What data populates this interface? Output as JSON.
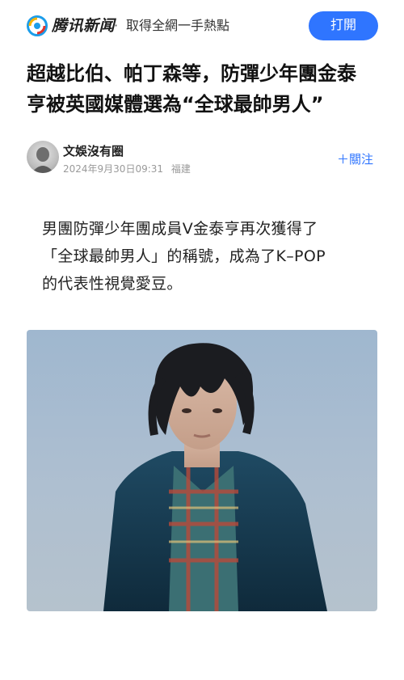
{
  "header": {
    "brand_name": "腾讯新闻",
    "separator": "·",
    "tagline": "取得全網一手熱點",
    "open_button": "打開",
    "accent_color": "#2f75ff"
  },
  "article": {
    "title_lines": [
      "超越比伯、帕丁森等，防彈少年團金泰",
      "亨被英國媒體選為“全球最帥男人”"
    ],
    "author": {
      "name": "文娛沒有圈",
      "date": "2024年9月30日09:31",
      "location": "福建",
      "follow_label": "＋關注"
    },
    "paragraph_lines": [
      "男團防彈少年團成員V金泰亨再次獲得了",
      "「全球最帥男人」的稱號，成為了K–POP",
      "的代表性視覺愛豆。"
    ]
  }
}
